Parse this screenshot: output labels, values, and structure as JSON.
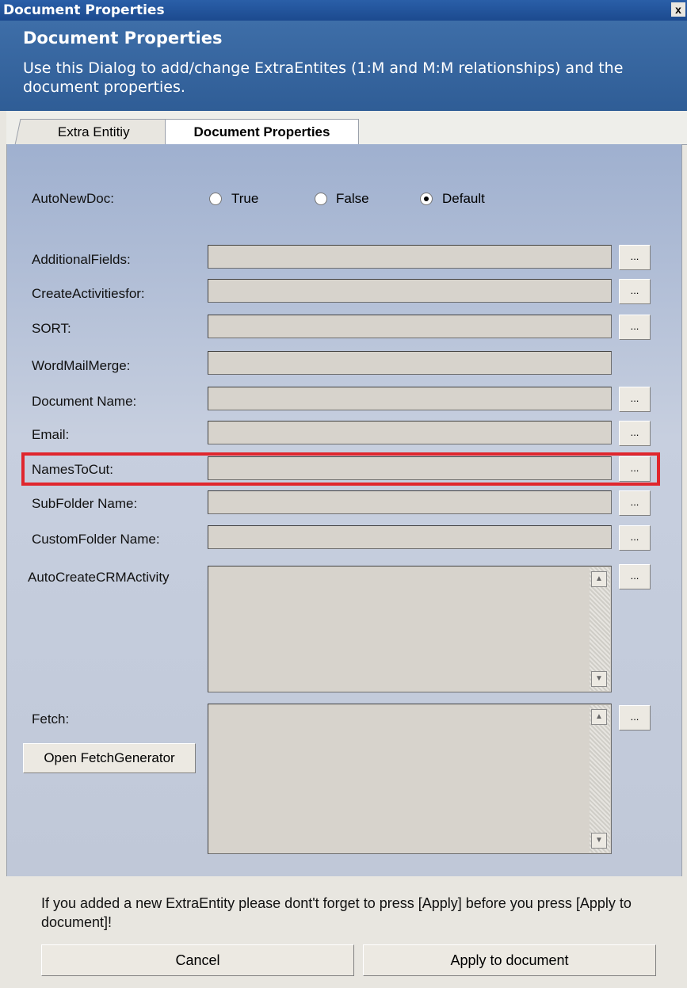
{
  "window": {
    "title": "Document Properties",
    "close_label": "x"
  },
  "header": {
    "title": "Document Properties",
    "description": "Use this Dialog to add/change ExtraEntites (1:M and M:M relationships) and the document properties."
  },
  "tabs": [
    {
      "label": "Extra Entitiy"
    },
    {
      "label": "Document Properties"
    }
  ],
  "autonewdoc": {
    "label": "AutoNewDoc:",
    "options": [
      "True",
      "False",
      "Default"
    ],
    "selected": "Default"
  },
  "fields": [
    {
      "label": "AdditionalFields:",
      "value": "",
      "has_browse": true
    },
    {
      "label": "CreateActivitiesfor:",
      "value": "",
      "has_browse": true
    },
    {
      "label": "SORT:",
      "value": "",
      "has_browse": true
    },
    {
      "label": "WordMailMerge:",
      "value": "",
      "has_browse": false
    },
    {
      "label": "Document Name:",
      "value": "",
      "has_browse": true
    },
    {
      "label": "Email:",
      "value": "",
      "has_browse": true
    },
    {
      "label": "NamesToCut:",
      "value": "",
      "has_browse": true
    },
    {
      "label": "SubFolder Name:",
      "value": "",
      "has_browse": true
    },
    {
      "label": "CustomFolder Name:",
      "value": "",
      "has_browse": true
    }
  ],
  "browse_label": "...",
  "autocreate": {
    "label": "AutoCreateCRMActivity",
    "value": ""
  },
  "fetch": {
    "label": "Fetch:",
    "value": "",
    "open_button": "Open FetchGenerator"
  },
  "footer": {
    "note": "If you added a new ExtraEntity please dont't forget to press [Apply] before you press [Apply to document]!",
    "cancel": "Cancel",
    "apply": "Apply to document"
  },
  "colors": {
    "highlight": "#e0262d",
    "title_bar": "#2a5fa8"
  }
}
